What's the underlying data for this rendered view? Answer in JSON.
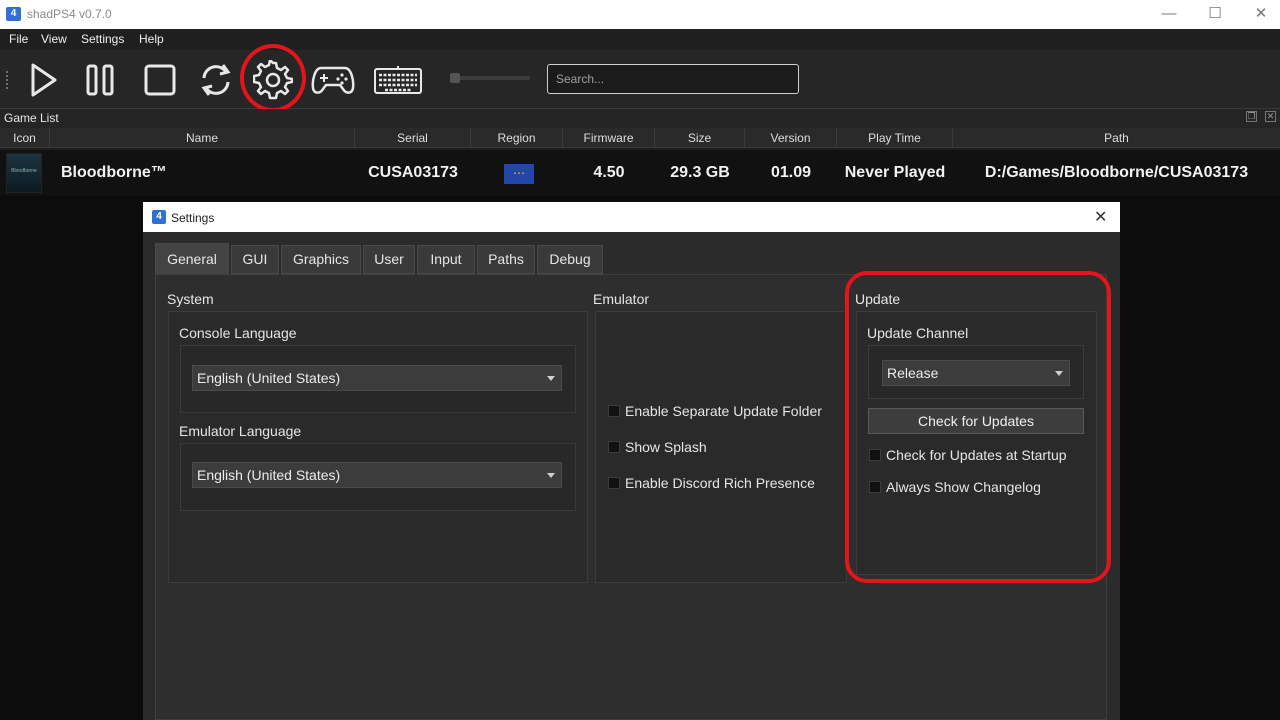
{
  "window": {
    "title": "shadPS4 v0.7.0",
    "app_icon": "4"
  },
  "menu": [
    "File",
    "View",
    "Settings",
    "Help"
  ],
  "toolbar": {
    "search_placeholder": "Search...",
    "buttons": [
      "play-icon",
      "pause-icon",
      "stop-icon",
      "refresh-icon",
      "gear-icon",
      "gamepad-icon",
      "keyboard-icon"
    ],
    "highlight_color": "#e4141c"
  },
  "game_list": {
    "dock_title": "Game List",
    "columns": [
      "Icon",
      "Name",
      "Serial",
      "Region",
      "Firmware",
      "Size",
      "Version",
      "Play Time",
      "Path"
    ],
    "rows": [
      {
        "icon_text": "Bloodborne",
        "name": "Bloodborne™",
        "serial": "CUSA03173",
        "region": "eu-flag",
        "firmware": "4.50",
        "size": "29.3 GB",
        "version": "01.09",
        "play_time": "Never Played",
        "path": "D:/Games/Bloodborne/CUSA03173"
      }
    ]
  },
  "settings": {
    "title": "Settings",
    "close_glyph": "✕",
    "tabs": [
      "General",
      "GUI",
      "Graphics",
      "User",
      "Input",
      "Paths",
      "Debug"
    ],
    "active_tab": "General",
    "system": {
      "title": "System",
      "console_language_label": "Console Language",
      "console_language_value": "English (United States)",
      "emulator_language_label": "Emulator Language",
      "emulator_language_value": "English (United States)"
    },
    "emulator": {
      "title": "Emulator",
      "separate_update_folder": "Enable Separate Update Folder",
      "show_splash": "Show Splash",
      "discord_rich_presence": "Enable Discord Rich Presence"
    },
    "update": {
      "title": "Update",
      "channel_label": "Update Channel",
      "channel_value": "Release",
      "check_button": "Check for Updates",
      "check_at_startup": "Check for Updates at Startup",
      "always_show_changelog": "Always Show Changelog"
    }
  }
}
